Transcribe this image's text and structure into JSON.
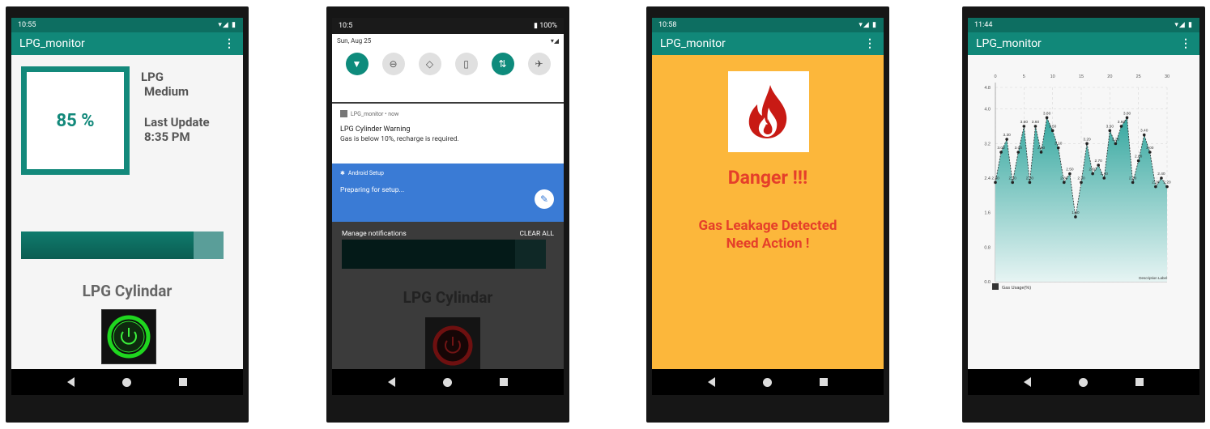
{
  "screen1": {
    "time": "10:55",
    "status_icons": "▾◢ ▮",
    "app_title": "LPG_monitor",
    "level_text": "85 %",
    "level_fraction": 0.85,
    "lpg_label": "LPG",
    "lpg_status": "Medium",
    "last_update_label": "Last Update",
    "last_update_time": "8:35 PM",
    "cylinder_label": "LPG Cylindar",
    "power_color": "#2fe62f"
  },
  "screen2": {
    "time": "10:5",
    "battery": "▮ 100%",
    "date": "Sun, Aug 25",
    "notif_app": "LPG_monitor • now",
    "notif_title": "LPG Cylinder Warning",
    "notif_body": "Gas is below 10%, recharge is required.",
    "setup_app": "Android Setup",
    "setup_text": "Preparing for setup...",
    "manage_label": "Manage notifications",
    "clear_label": "CLEAR ALL",
    "cylinder_label": "LPG Cylindar"
  },
  "screen3": {
    "time": "10:58",
    "status_icons": "▾◢ ▮",
    "app_title": "LPG_monitor",
    "danger_text": "Danger !!!",
    "leak_line1": "Gas Leakage Detected",
    "leak_line2": "Need Action !"
  },
  "screen4": {
    "time": "11:44",
    "status_icons": "▾◢ ▮",
    "app_title": "LPG_monitor"
  },
  "chart_data": {
    "type": "area",
    "title": "",
    "xlabel": "",
    "ylabel": "",
    "xlim": [
      0,
      30
    ],
    "ylim": [
      0,
      4.5
    ],
    "x_ticks": [
      "0",
      "5",
      "10",
      "15",
      "20",
      "25",
      "30"
    ],
    "y_ticks": [
      "0.0",
      "0.8",
      "1.6",
      "2.4",
      "3.2",
      "4.0",
      "4.8"
    ],
    "legend": [
      "Gas Usage(%)"
    ],
    "description_label": "Description Label",
    "series": [
      {
        "name": "Gas Usage(%)",
        "x": [
          0,
          1,
          2,
          3,
          4,
          5,
          6,
          7,
          8,
          9,
          10,
          11,
          12,
          13,
          14,
          15,
          16,
          17,
          18,
          19,
          20,
          21,
          22,
          23,
          24,
          25,
          26,
          27,
          28,
          29,
          30
        ],
        "values": [
          2.3,
          3.0,
          3.3,
          2.3,
          3.0,
          3.6,
          2.3,
          3.6,
          3.0,
          3.8,
          3.5,
          3.1,
          2.3,
          2.5,
          1.5,
          2.3,
          3.2,
          2.5,
          2.7,
          2.4,
          3.5,
          3.2,
          3.6,
          3.8,
          2.3,
          2.8,
          3.4,
          3.0,
          2.2,
          2.4,
          2.2
        ],
        "point_labels": [
          "2.30",
          "3.00",
          "3.30",
          "2.30",
          "3.00",
          "3.60",
          "2.30",
          "3.60",
          "3.00",
          "3.80",
          "3.50",
          "3.10",
          "2.30",
          "2.50",
          "1.50",
          "2.30",
          "3.20",
          "2.50",
          "2.70",
          "2.40",
          "3.50",
          "3.20",
          "3.60",
          "3.80",
          "2.30",
          "2.80",
          "3.40",
          "3.00",
          "2.20",
          "2.40",
          "2.20"
        ]
      }
    ],
    "grid": true,
    "colors": {
      "line": "#2a2a2a",
      "fill_top": "#37a8a0",
      "fill_bottom": "#e6f4f3"
    }
  },
  "nav": {
    "back": "back",
    "home": "home",
    "recent": "recent"
  }
}
